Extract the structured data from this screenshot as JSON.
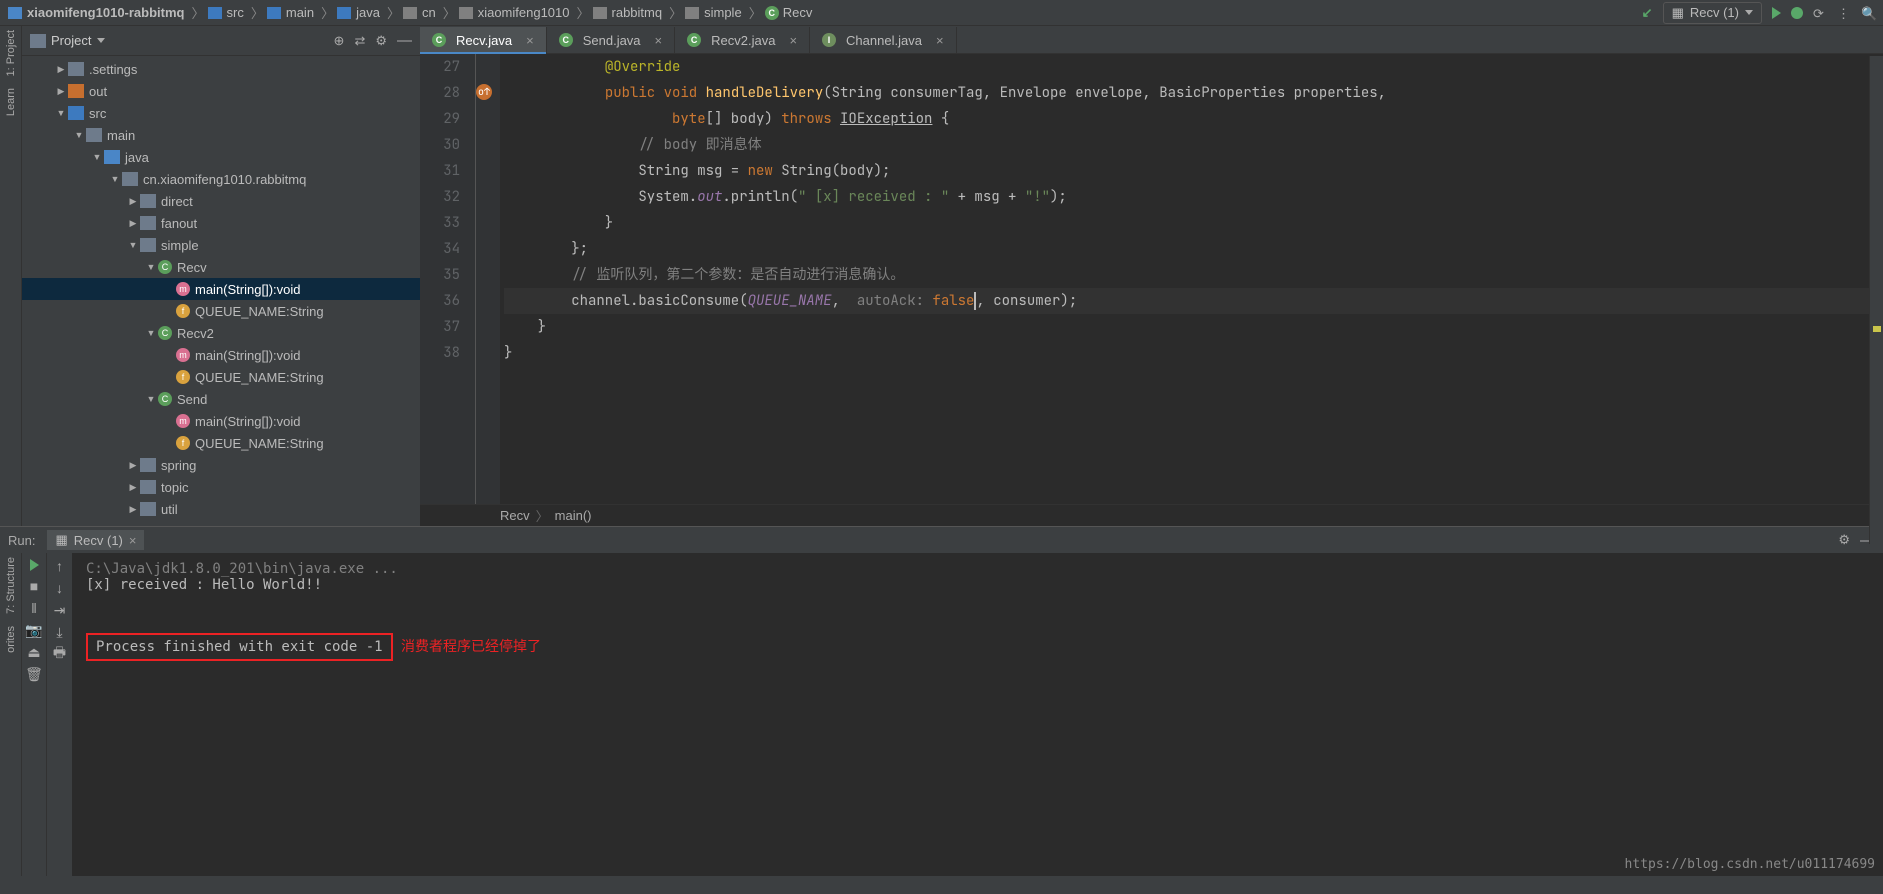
{
  "breadcrumbs": [
    "xiaomifeng1010-rabbitmq",
    "src",
    "main",
    "java",
    "cn",
    "xiaomifeng1010",
    "rabbitmq",
    "simple",
    "Recv"
  ],
  "run_config": "Recv (1)",
  "project": {
    "title": "Project",
    "tree": [
      {
        "indent": 1,
        "caret": "right",
        "icon": "folder",
        "label": ".settings"
      },
      {
        "indent": 1,
        "caret": "right",
        "icon": "folder-highlight",
        "label": "out"
      },
      {
        "indent": 1,
        "caret": "down",
        "icon": "folder-src",
        "label": "src"
      },
      {
        "indent": 2,
        "caret": "down",
        "icon": "folder",
        "label": "main"
      },
      {
        "indent": 3,
        "caret": "down",
        "icon": "folder-blue",
        "label": "java"
      },
      {
        "indent": 4,
        "caret": "down",
        "icon": "folder",
        "label": "cn.xiaomifeng1010.rabbitmq"
      },
      {
        "indent": 5,
        "caret": "right",
        "icon": "folder",
        "label": "direct"
      },
      {
        "indent": 5,
        "caret": "right",
        "icon": "folder",
        "label": "fanout"
      },
      {
        "indent": 5,
        "caret": "down",
        "icon": "folder",
        "label": "simple"
      },
      {
        "indent": 6,
        "caret": "down",
        "icon": "class",
        "label": "Recv"
      },
      {
        "indent": 7,
        "caret": "none",
        "icon": "method",
        "label": "main(String[]):void",
        "selected": true
      },
      {
        "indent": 7,
        "caret": "none",
        "icon": "field",
        "label": "QUEUE_NAME:String"
      },
      {
        "indent": 6,
        "caret": "down",
        "icon": "class",
        "label": "Recv2"
      },
      {
        "indent": 7,
        "caret": "none",
        "icon": "method",
        "label": "main(String[]):void"
      },
      {
        "indent": 7,
        "caret": "none",
        "icon": "field",
        "label": "QUEUE_NAME:String"
      },
      {
        "indent": 6,
        "caret": "down",
        "icon": "class",
        "label": "Send"
      },
      {
        "indent": 7,
        "caret": "none",
        "icon": "method",
        "label": "main(String[]):void"
      },
      {
        "indent": 7,
        "caret": "none",
        "icon": "field",
        "label": "QUEUE_NAME:String"
      },
      {
        "indent": 5,
        "caret": "right",
        "icon": "folder",
        "label": "spring"
      },
      {
        "indent": 5,
        "caret": "right",
        "icon": "folder",
        "label": "topic"
      },
      {
        "indent": 5,
        "caret": "right",
        "icon": "folder",
        "label": "util"
      }
    ]
  },
  "tabs": [
    {
      "name": "Recv.java",
      "icon": "class",
      "active": true
    },
    {
      "name": "Send.java",
      "icon": "class"
    },
    {
      "name": "Recv2.java",
      "icon": "class"
    },
    {
      "name": "Channel.java",
      "icon": "interface"
    }
  ],
  "code_lines": {
    "start": 27,
    "lines": [
      {
        "n": 27,
        "html": "            <span class='ann'>@Override</span>"
      },
      {
        "n": 28,
        "html": "            <span class='kw'>public void</span> <span class='mth'>handleDelivery</span>(String consumerTag, Envelope envelope, BasicProperties properties,"
      },
      {
        "n": 29,
        "html": "                    <span class='kw'>byte</span>[] body) <span class='kw'>throws</span> <span class='underl'>IOException</span> {"
      },
      {
        "n": 30,
        "html": "                <span class='cmt'>// body 即消息体</span>"
      },
      {
        "n": 31,
        "html": "                String msg = <span class='kw'>new</span> String(body);"
      },
      {
        "n": 32,
        "html": "                System.<span class='fld'>out</span>.println(<span class='str'>\" [x] received : \"</span> + msg + <span class='str'>\"!\"</span>);"
      },
      {
        "n": 33,
        "html": "            }"
      },
      {
        "n": 34,
        "html": "        };"
      },
      {
        "n": 35,
        "html": "        <span class='cmt'>// 监听队列，第二个参数：是否自动进行消息确认。</span>"
      },
      {
        "n": 36,
        "html": "        channel.basicConsume(<span class='fld'>QUEUE_NAME</span>,  <span class='param'>autoAck:</span> <span class='fals'>false</span><span class='cursor'></span>, consumer);",
        "hl": true
      },
      {
        "n": 37,
        "html": "    }"
      },
      {
        "n": 38,
        "html": "}"
      }
    ]
  },
  "breadcrumb2": {
    "class": "Recv",
    "method": "main()"
  },
  "run_panel": {
    "label": "Run:",
    "tab": "Recv (1)",
    "cmd": "C:\\Java\\jdk1.8.0_201\\bin\\java.exe ...",
    "out": "  [x] received : Hello World!!",
    "exit": "Process finished with exit code -1",
    "annotation": "消费者程序已经停掉了"
  },
  "side_labels": {
    "project": "1: Project",
    "learn": "Learn",
    "structure": "7: Structure",
    "favorites": "orites"
  },
  "watermark": "https://blog.csdn.net/u011174699"
}
